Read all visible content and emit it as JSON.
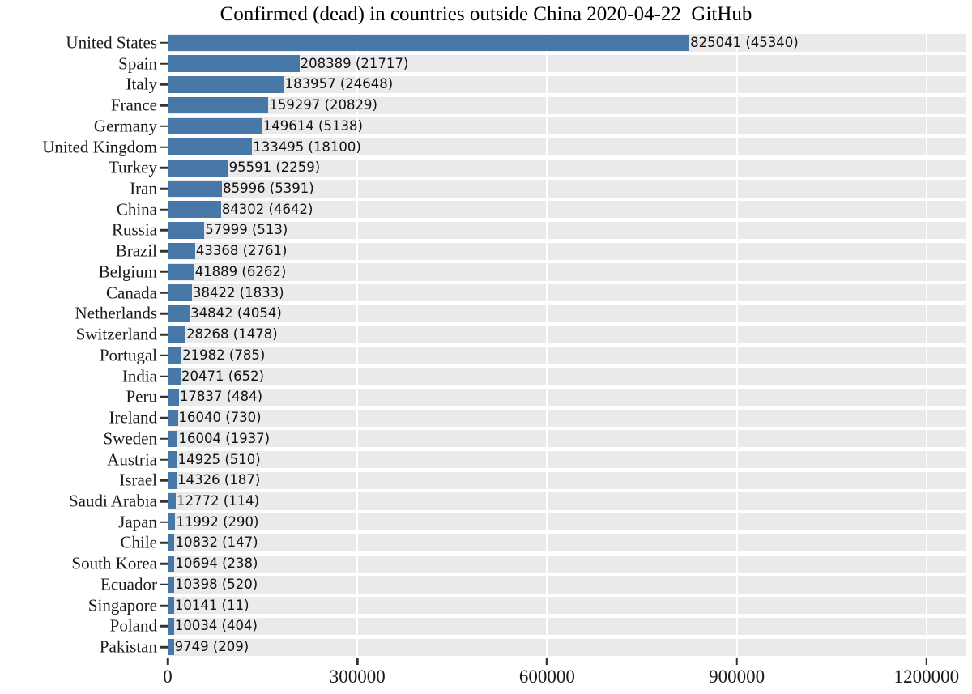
{
  "chart_data": {
    "type": "bar",
    "orientation": "horizontal",
    "title": "Confirmed (dead) in countries outside China 2020-04-22  GitHub",
    "xlabel": "",
    "ylabel": "",
    "xlim": [
      0,
      1263000
    ],
    "grid": true,
    "legend": null,
    "bar_color": "#4878a8",
    "panel_background": "#eaeaea",
    "gridline_color": "#ffffff",
    "xticks": [
      0,
      300000,
      600000,
      900000,
      1200000
    ],
    "xticklabels": [
      "0",
      "300000",
      "600000",
      "900000",
      "1200000"
    ],
    "categories": [
      "United States",
      "Spain",
      "Italy",
      "France",
      "Germany",
      "United Kingdom",
      "Turkey",
      "Iran",
      "China",
      "Russia",
      "Brazil",
      "Belgium",
      "Canada",
      "Netherlands",
      "Switzerland",
      "Portugal",
      "India",
      "Peru",
      "Ireland",
      "Sweden",
      "Austria",
      "Israel",
      "Saudi Arabia",
      "Japan",
      "Chile",
      "South Korea",
      "Ecuador",
      "Singapore",
      "Poland",
      "Pakistan"
    ],
    "values": [
      825041,
      208389,
      183957,
      159297,
      149614,
      133495,
      95591,
      85996,
      84302,
      57999,
      43368,
      41889,
      38422,
      34842,
      28268,
      21982,
      20471,
      17837,
      16040,
      16004,
      14925,
      14326,
      12772,
      11992,
      10832,
      10694,
      10398,
      10141,
      10034,
      9749
    ],
    "deaths": [
      45340,
      21717,
      24648,
      20829,
      5138,
      18100,
      2259,
      5391,
      4642,
      513,
      2761,
      6262,
      1833,
      4054,
      1478,
      785,
      652,
      484,
      730,
      1937,
      510,
      187,
      114,
      290,
      147,
      238,
      520,
      11,
      404,
      209
    ],
    "bar_labels": [
      "825041 (45340)",
      "208389 (21717)",
      "183957 (24648)",
      "159297 (20829)",
      "149614 (5138)",
      "133495 (18100)",
      "95591 (2259)",
      "85996 (5391)",
      "84302 (4642)",
      "57999 (513)",
      "43368 (2761)",
      "41889 (6262)",
      "38422 (1833)",
      "34842 (4054)",
      "28268 (1478)",
      "21982 (785)",
      "20471 (652)",
      "17837 (484)",
      "16040 (730)",
      "16004 (1937)",
      "14925 (510)",
      "14326 (187)",
      "12772 (114)",
      "11992 (290)",
      "10832 (147)",
      "10694 (238)",
      "10398 (520)",
      "10141 (11)",
      "10034 (404)",
      "9749 (209)"
    ]
  }
}
